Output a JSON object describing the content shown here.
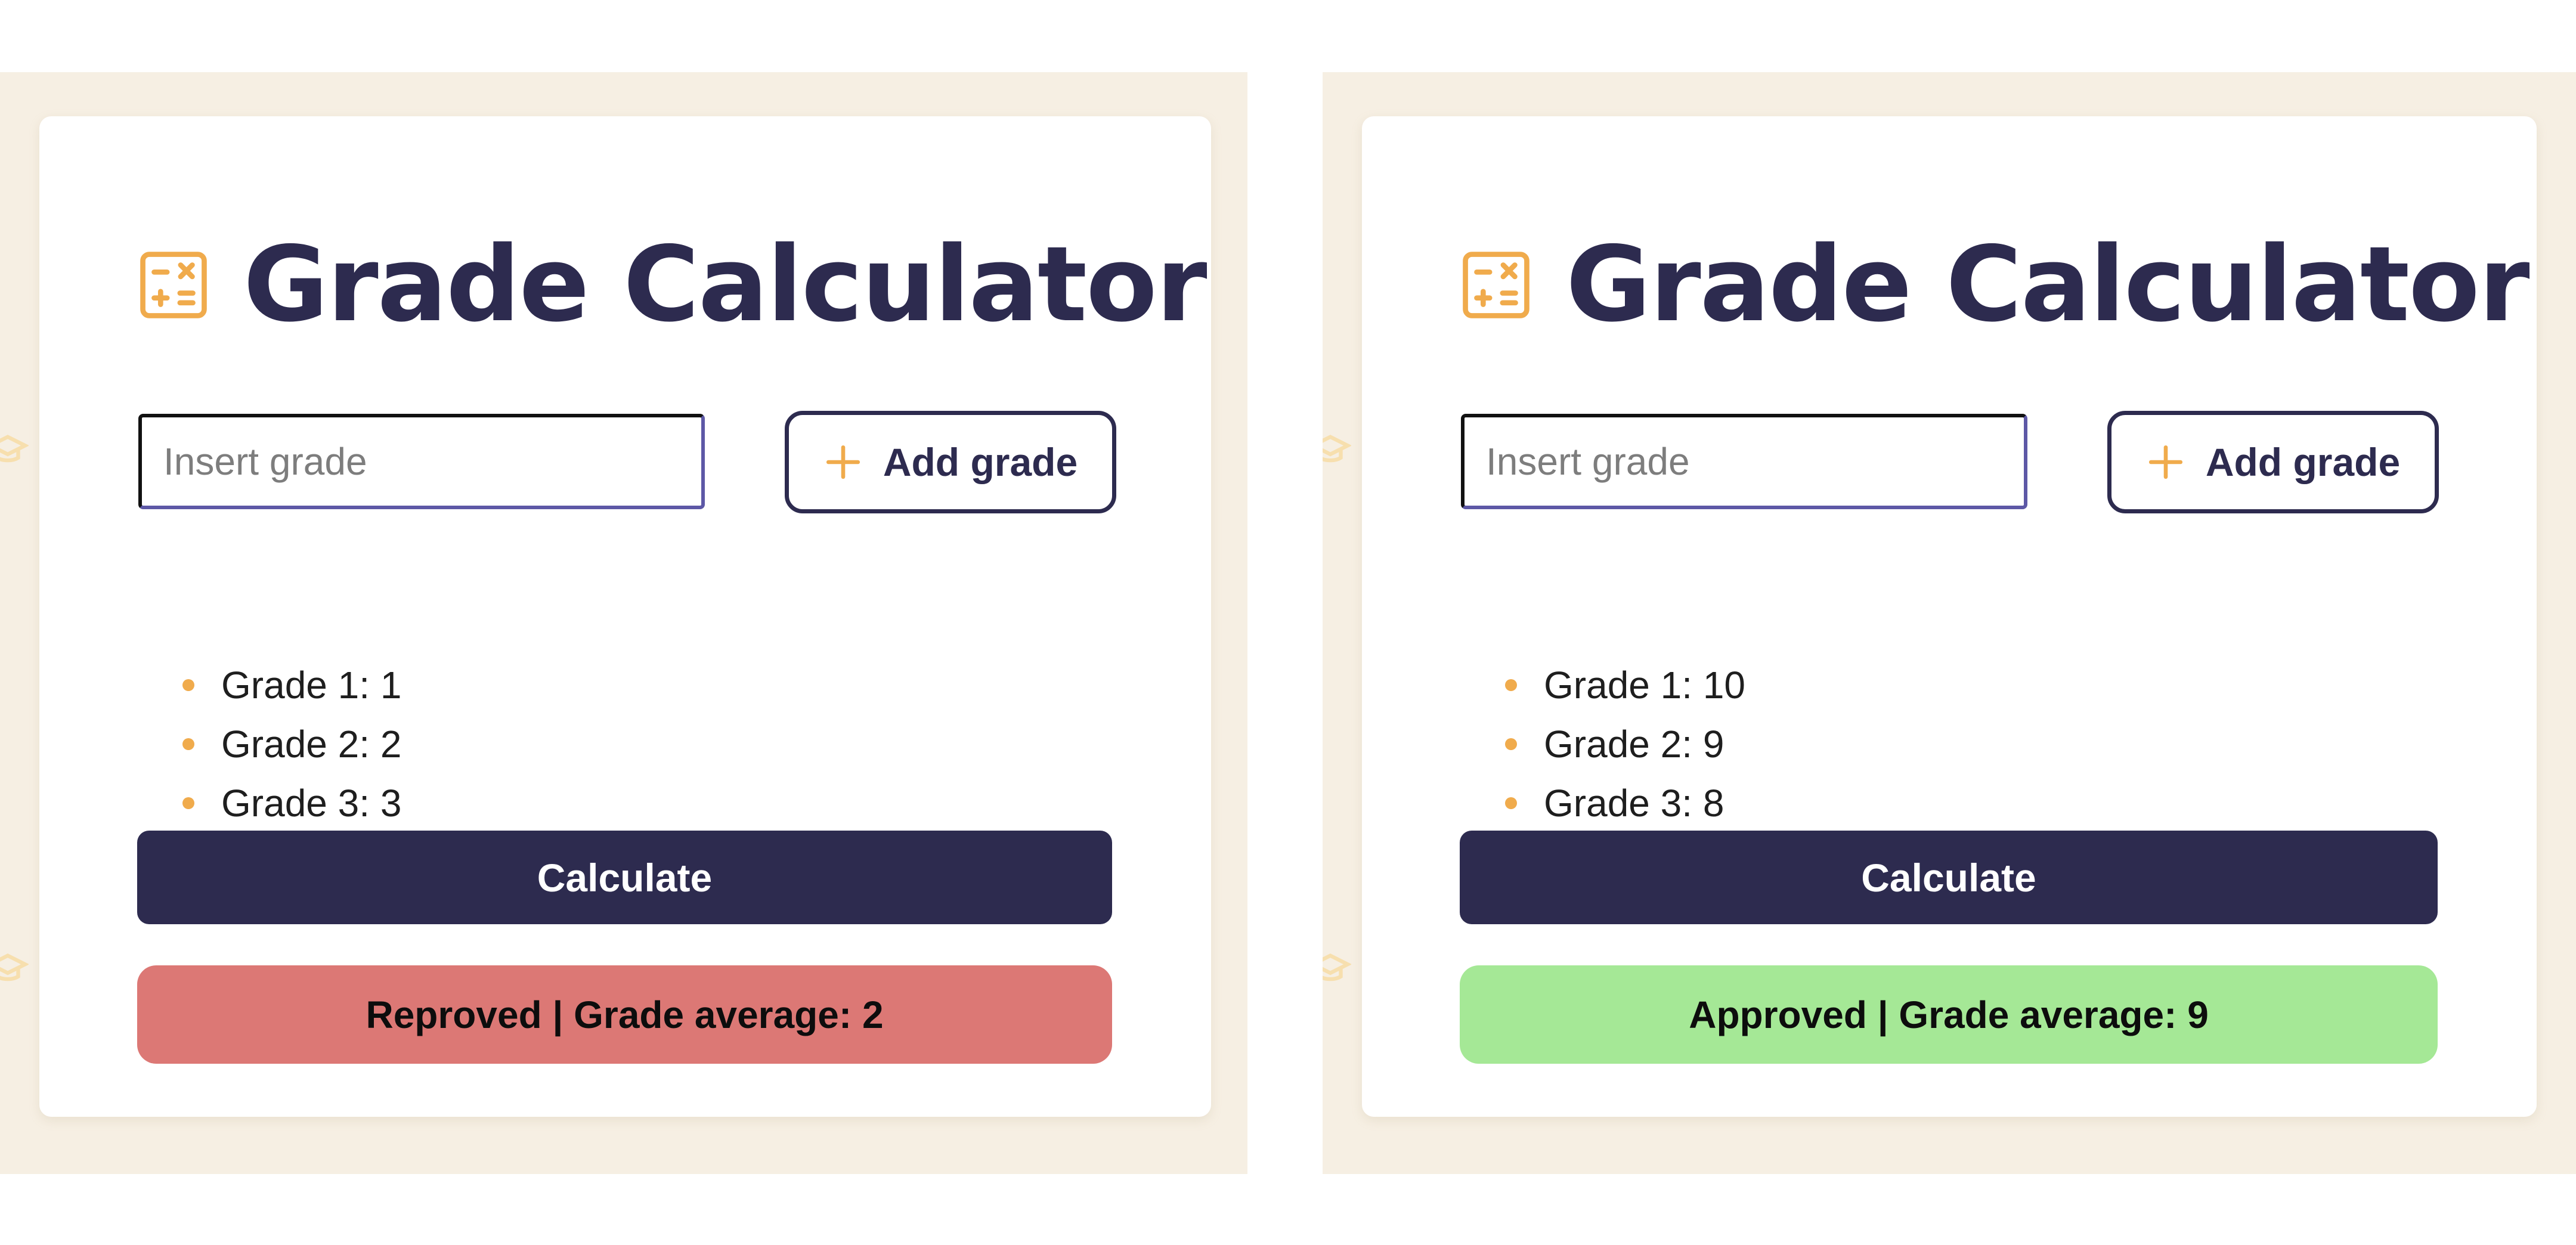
{
  "colors": {
    "background": "#f6efe3",
    "card": "#ffffff",
    "title": "#2d2b4f",
    "accent": "#f0ab4c",
    "button": "#2d2b4f",
    "fail": "#dc7875",
    "pass": "#a5e896"
  },
  "icons": {
    "title": "calculator-icon",
    "add": "plus-icon",
    "bullet": "dot",
    "decoration": "graduation-cap-icon"
  },
  "left": {
    "title": "Grade Calculator",
    "input": {
      "placeholder": "Insert grade",
      "value": ""
    },
    "add_button": "Add grade",
    "grades": [
      "Grade 1: 1",
      "Grade 2: 2",
      "Grade 3: 3"
    ],
    "calculate_button": "Calculate",
    "result": {
      "text": "Reproved | Grade average: 2",
      "status": "fail"
    }
  },
  "right": {
    "title": "Grade Calculator",
    "input": {
      "placeholder": "Insert grade",
      "value": ""
    },
    "add_button": "Add grade",
    "grades": [
      "Grade 1: 10",
      "Grade 2: 9",
      "Grade 3: 8"
    ],
    "calculate_button": "Calculate",
    "result": {
      "text": "Approved | Grade average: 9",
      "status": "pass"
    }
  }
}
